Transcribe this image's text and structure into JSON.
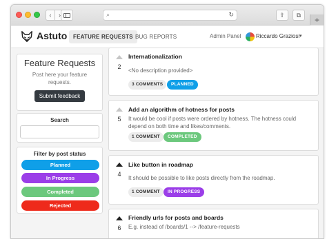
{
  "app": {
    "brand": "Astuto"
  },
  "nav": {
    "feature_requests": "FEATURE REQUESTS",
    "bug_reports": "BUG REPORTS",
    "admin_panel": "Admin Panel",
    "user_name": "Riccardo Graziosi",
    "caret": "▾"
  },
  "chrome": {
    "back": "‹",
    "forward": "›",
    "search_glyph": "⌕",
    "reload_glyph": "↻",
    "share_glyph": "⇧",
    "tabs_glyph": "⧉",
    "newtab_glyph": "+"
  },
  "sidebar": {
    "board_title": "Feature Requests",
    "board_subtitle": "Post here your feature requests.",
    "submit_label": "Submit feedback",
    "search_title": "Search",
    "filter_title": "Filter by post status",
    "statuses": [
      {
        "label": "Planned",
        "color": "#0f9fe8"
      },
      {
        "label": "In Progress",
        "color": "#9b3ee8"
      },
      {
        "label": "Completed",
        "color": "#6cc87d"
      },
      {
        "label": "Rejected",
        "color": "#ee2a1b"
      }
    ]
  },
  "posts": [
    {
      "title": "Internationalization",
      "description": "<No description provided>",
      "votes": "2",
      "voted": false,
      "comments": "3 COMMENTS",
      "status": "PLANNED",
      "status_color": "#0f9fe8"
    },
    {
      "title": "Add an algorithm of hotness for posts",
      "description": "It would be cool if posts were ordered by hotness. The hotness could depend on both time and likes/comments.",
      "votes": "5",
      "voted": false,
      "comments": "1 COMMENT",
      "status": "COMPLETED",
      "status_color": "#6cc87d"
    },
    {
      "title": "Like button in roadmap",
      "description": "It should be possible to like posts directly from the roadmap.",
      "votes": "4",
      "voted": true,
      "comments": "1 COMMENT",
      "status": "IN PROGRESS",
      "status_color": "#9b3ee8"
    },
    {
      "title": "Friendly urls for posts and boards",
      "description": "E.g. instead of /boards/1 --> /feature-requests",
      "votes": "6",
      "voted": true
    }
  ]
}
